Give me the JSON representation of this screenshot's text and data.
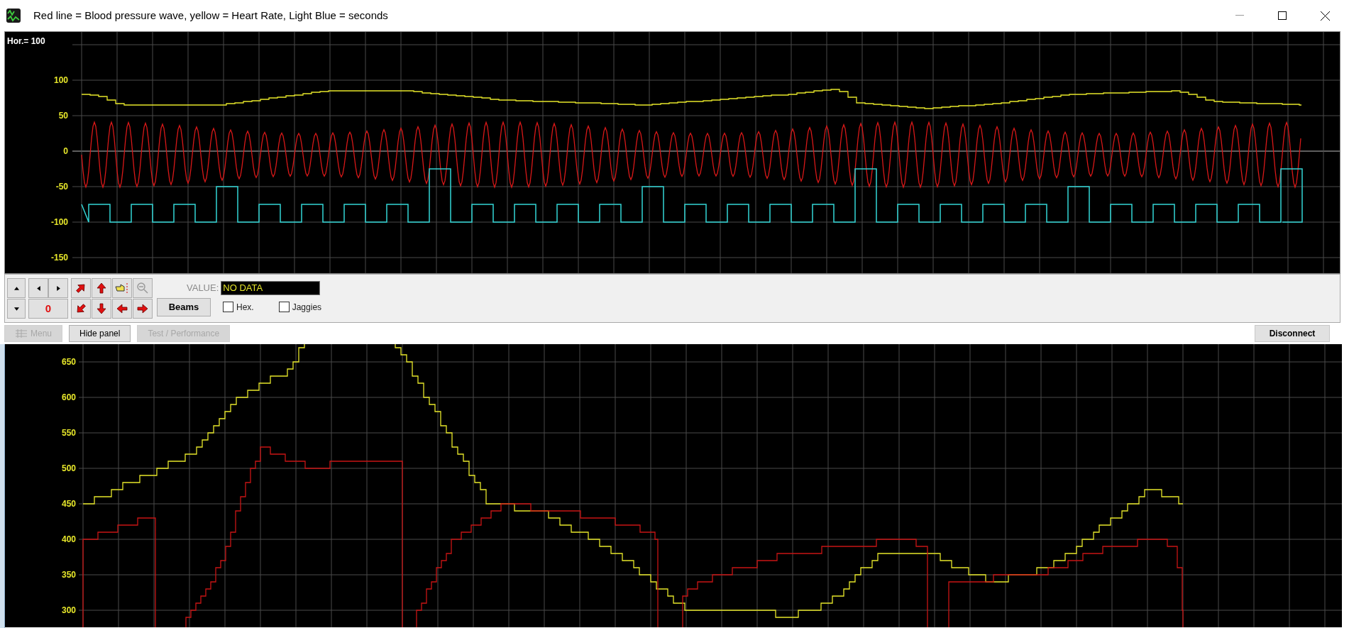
{
  "window": {
    "title": "Red line = Blood pressure wave, yellow = Heart Rate, Light Blue = seconds"
  },
  "scope": {
    "scale_label": "Hor.= 100",
    "y_axis_labels": [
      "100",
      "50",
      "0",
      "-50",
      "-100",
      "-150"
    ]
  },
  "controls": {
    "counter": "0",
    "beams_button": "Beams",
    "value_label": "VALUE:",
    "value_field": "NO DATA",
    "checkboxes": [
      {
        "label": "Hex.",
        "checked": false
      },
      {
        "label": "Jaggies",
        "checked": false
      }
    ]
  },
  "buttons": [
    {
      "label": "Menu",
      "disabled": true
    },
    {
      "label": "Hide panel",
      "disabled": false
    },
    {
      "label": "Test / Performance",
      "disabled": true
    }
  ],
  "disconnect_button": "Disconnect",
  "trend": {
    "y_axis_labels": [
      "650",
      "600",
      "550",
      "500",
      "450",
      "400",
      "350",
      "300"
    ]
  }
}
